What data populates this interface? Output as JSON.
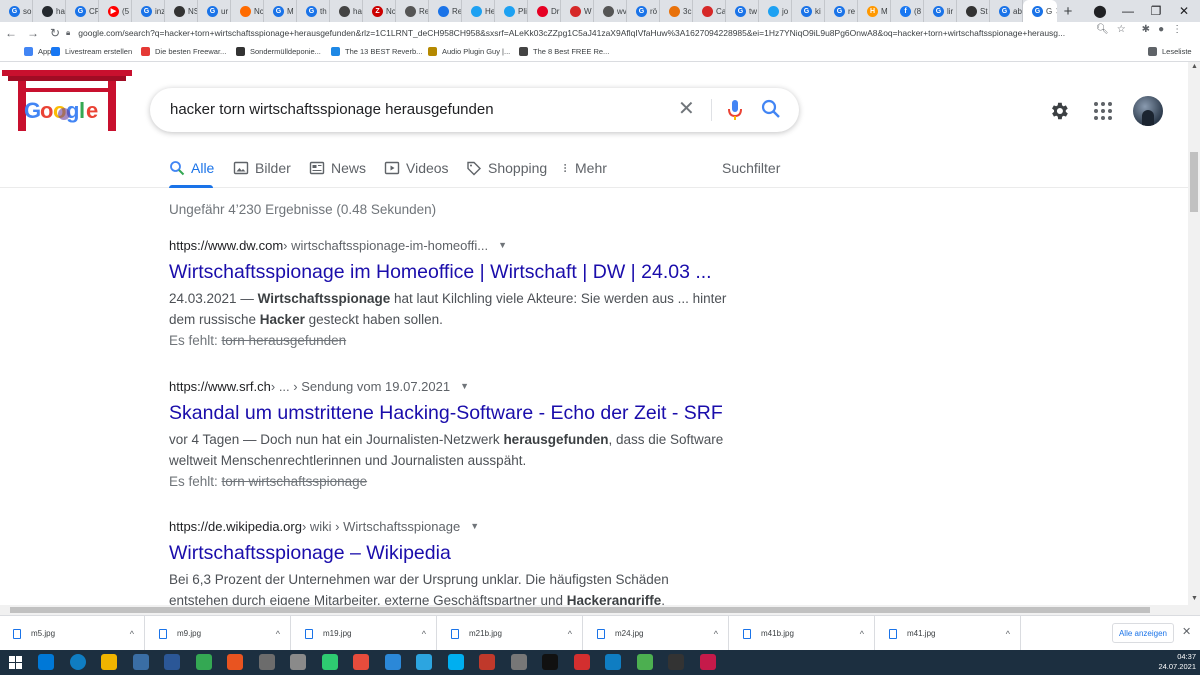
{
  "browser": {
    "tabs": [
      {
        "label": "so",
        "color": "#1a73e8",
        "glyph": "G"
      },
      {
        "label": "ha",
        "color": "#24292e",
        "glyph": ""
      },
      {
        "label": "CF",
        "color": "#1a73e8",
        "glyph": "G"
      },
      {
        "label": "(5",
        "color": "#ff0000",
        "glyph": "▶"
      },
      {
        "label": "inz",
        "color": "#1a73e8",
        "glyph": "G"
      },
      {
        "label": "NS",
        "color": "#333333",
        "glyph": ""
      },
      {
        "label": "ur",
        "color": "#1a73e8",
        "glyph": "G"
      },
      {
        "label": "Nc",
        "color": "#ff6b00",
        "glyph": ""
      },
      {
        "label": "M",
        "color": "#1a73e8",
        "glyph": "G"
      },
      {
        "label": "th",
        "color": "#1a73e8",
        "glyph": "G"
      },
      {
        "label": "ha",
        "color": "#444444",
        "glyph": ""
      },
      {
        "label": "Nc",
        "color": "#cc0000",
        "glyph": "Z"
      },
      {
        "label": "Re",
        "color": "#555555",
        "glyph": ""
      },
      {
        "label": "Re",
        "color": "#1a73e8",
        "glyph": ""
      },
      {
        "label": "He",
        "color": "#1da1f2",
        "glyph": ""
      },
      {
        "label": "Pli",
        "color": "#1da1f2",
        "glyph": ""
      },
      {
        "label": "Dr",
        "color": "#e60023",
        "glyph": ""
      },
      {
        "label": "W",
        "color": "#d62828",
        "glyph": ""
      },
      {
        "label": "wv",
        "color": "#555555",
        "glyph": ""
      },
      {
        "label": "rö",
        "color": "#1a73e8",
        "glyph": "G"
      },
      {
        "label": "3c",
        "color": "#e8710a",
        "glyph": ""
      },
      {
        "label": "Ca",
        "color": "#d62828",
        "glyph": ""
      },
      {
        "label": "tw",
        "color": "#1a73e8",
        "glyph": "G"
      },
      {
        "label": "jo",
        "color": "#1da1f2",
        "glyph": ""
      },
      {
        "label": "ki",
        "color": "#1a73e8",
        "glyph": "G"
      },
      {
        "label": "re",
        "color": "#1a73e8",
        "glyph": "G"
      },
      {
        "label": "M",
        "color": "#ff9800",
        "glyph": "H"
      },
      {
        "label": "(8",
        "color": "#1877f2",
        "glyph": "f"
      },
      {
        "label": "lir",
        "color": "#1a73e8",
        "glyph": "G"
      },
      {
        "label": "St",
        "color": "#333333",
        "glyph": ""
      },
      {
        "label": "ab",
        "color": "#1a73e8",
        "glyph": "G"
      },
      {
        "label": "G",
        "color": "#1a73e8",
        "glyph": "G",
        "active": true
      }
    ],
    "new_tab": "+",
    "url": "google.com/search?q=hacker+torn+wirtschaftsspionage+herausgefunden&rlz=1C1LRNT_deCH958CH958&sxsrf=ALeKk03cZZpg1C5aJ41zaX9AflqIVfaHuw%3A1627094228985&ei=1Hz7YNiqO9iL9u8Pg6OnwA8&oq=hacker+torn+wirtschaftsspionage+herausg..."
  },
  "bookmarks": [
    {
      "label": "Apps",
      "color": "#4285f4"
    },
    {
      "label": "Livestream erstellen",
      "color": "#1877f2"
    },
    {
      "label": "Die besten Freewar...",
      "color": "#e53935"
    },
    {
      "label": "Sondermülldeponie...",
      "color": "#333333"
    },
    {
      "label": "The 13 BEST Reverb...",
      "color": "#1e88e5"
    },
    {
      "label": "Audio Plugin Guy |...",
      "color": "#b58900"
    },
    {
      "label": "The 8 Best FREE Re...",
      "color": "#444444"
    }
  ],
  "reading_list": "Leseliste",
  "search": {
    "query": "hacker torn wirtschaftsspionage herausgefunden",
    "tabs": [
      {
        "label": "Alle",
        "icon": "search-icon",
        "active": true
      },
      {
        "label": "Bilder",
        "icon": "image-icon"
      },
      {
        "label": "News",
        "icon": "news-icon"
      },
      {
        "label": "Videos",
        "icon": "video-icon"
      },
      {
        "label": "Shopping",
        "icon": "tag-icon"
      },
      {
        "label": "Mehr",
        "icon": "more-vert-icon"
      }
    ],
    "filters": "Suchfilter",
    "stats": "Ungefähr 4’230 Ergebnisse (0.48 Sekunden)",
    "results": [
      {
        "domain": "https://www.dw.com",
        "path": " › wirtschaftsspionage-im-homeoffi...",
        "title": "Wirtschaftsspionage im Homeoffice | Wirtschaft | DW | 24.03 ...",
        "snippet": [
          {
            "t": "24.03.2021 — "
          },
          {
            "t": "Wirtschaftsspionage",
            "b": true
          },
          {
            "t": " hat laut Kilchling viele Akteure: Sie werden aus ... hinter dem russische "
          },
          {
            "t": "Hacker",
            "b": true
          },
          {
            "t": " gesteckt haben sollen."
          }
        ],
        "missing_label": "Es fehlt:",
        "missing_terms": "torn herausgefunden"
      },
      {
        "domain": "https://www.srf.ch",
        "path": " › ... › Sendung vom 19.07.2021",
        "title": "Skandal um umstrittene Hacking-Software - Echo der Zeit - SRF",
        "snippet": [
          {
            "t": "vor 4 Tagen — Doch nun hat ein Journalisten-Netzwerk "
          },
          {
            "t": "herausgefunden",
            "b": true
          },
          {
            "t": ", dass die Software weltweit Menschenrechtlerinnen und Journalisten ausspäht."
          }
        ],
        "missing_label": "Es fehlt:",
        "missing_terms": "torn wirtschaftsspionage"
      },
      {
        "domain": "https://de.wikipedia.org",
        "path": " › wiki › Wirtschaftsspionage",
        "title": "Wirtschaftsspionage – Wikipedia",
        "snippet": [
          {
            "t": "Bei 6,3 Prozent der Unternehmen war der Ursprung unklar. Die häufigsten Schäden entstehen durch eigene Mitarbeiter, externe Geschäftspartner und "
          },
          {
            "t": "Hackerangriffe",
            "b": true
          },
          {
            "t": "."
          }
        ]
      }
    ]
  },
  "downloads": {
    "files": [
      "m5.jpg",
      "m9.jpg",
      "m19.jpg",
      "m21b.jpg",
      "m24.jpg",
      "m41b.jpg",
      "m41.jpg"
    ],
    "show_all": "Alle anzeigen"
  },
  "taskbar": {
    "time": "04:37",
    "date": "24.07.2021",
    "app_colors": [
      "#0078d7",
      "#0f7dc2",
      "#f0b400",
      "#3a6ea5",
      "#2b5797",
      "#34a853",
      "#e95420",
      "#6c6c6c",
      "#8a8a8a",
      "#2ecc71",
      "#e74c3c",
      "#2b88d8",
      "#2ca5e0",
      "#00aff0",
      "#c0392b",
      "#777777",
      "#111111",
      "#d32f2f",
      "#0f7dc2",
      "#4caf50",
      "#333333",
      "#c51a4a"
    ]
  },
  "colors": {
    "link": "#1a0dab",
    "accent": "#1a73e8",
    "snippet": "#4d5156"
  }
}
